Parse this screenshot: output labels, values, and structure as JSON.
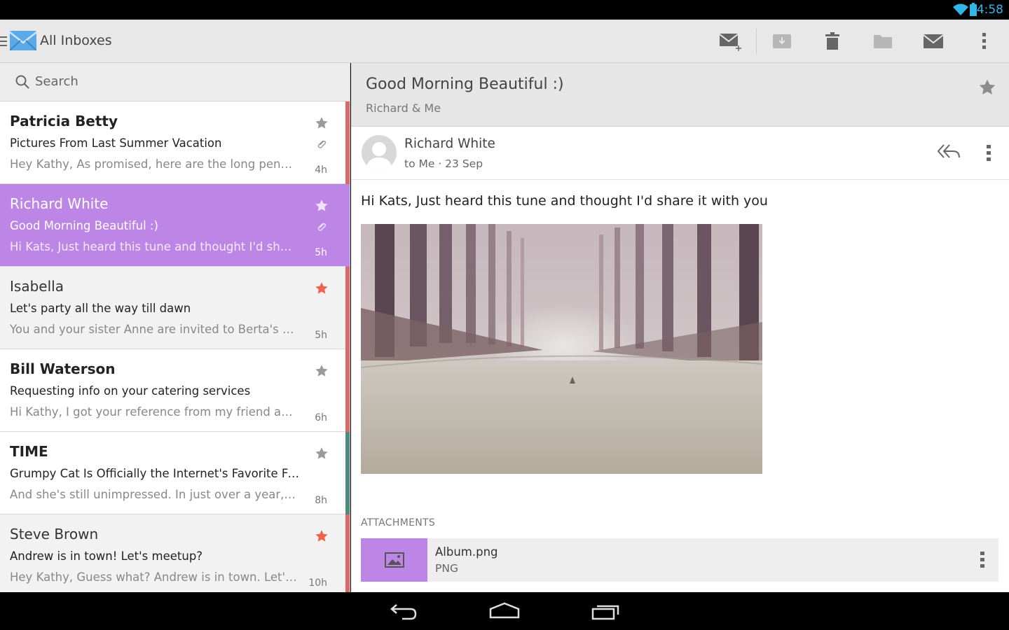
{
  "status": {
    "time": "4:58"
  },
  "appbar": {
    "title": "All Inboxes",
    "icons": [
      "compose-icon",
      "archive-icon",
      "trash-icon",
      "folder-icon",
      "mail-icon",
      "overflow-icon"
    ]
  },
  "search": {
    "placeholder": "Search"
  },
  "mails": [
    {
      "sender": "Patricia Betty",
      "subject": "Pictures From Last Summer Vacation",
      "preview": "Hey Kathy, As promised, here are the long pending pictures from our summer vacation",
      "time": "4h",
      "starred": false,
      "attachment": true,
      "state": "unread",
      "bar_color": "#d96a6a"
    },
    {
      "sender": "Richard White",
      "subject": "Good Morning Beautiful :)",
      "preview": "Hi Kats, Just heard this tune and thought I'd share it with you",
      "time": "5h",
      "starred": false,
      "attachment": true,
      "state": "selected",
      "bar_color": "#bd86e6"
    },
    {
      "sender": "Isabella",
      "subject": "Let's party all the way till dawn",
      "preview": "You and your sister Anne are invited to Berta's backyard party",
      "time": "5h",
      "starred": true,
      "attachment": false,
      "state": "read",
      "bar_color": "#d96a6a"
    },
    {
      "sender": "Bill Waterson",
      "subject": "Requesting info on your catering services",
      "preview": "Hi Kathy, I got your reference from my friend and would like to know more",
      "time": "6h",
      "starred": false,
      "attachment": false,
      "state": "unread",
      "bar_color": "#d96a6a"
    },
    {
      "sender": "TIME",
      "subject": "Grumpy Cat Is Officially the Internet's Favorite Feline",
      "preview": "And she's still unimpressed. In just over a year, Grumpy Cat has become",
      "time": "8h",
      "starred": false,
      "attachment": false,
      "state": "unread",
      "bar_color": "#4f8a7f"
    },
    {
      "sender": "Steve Brown",
      "subject": "Andrew is in town! Let's meetup?",
      "preview": "Hey Kathy, Guess what? Andrew is in town. Let's all meet up tonight",
      "time": "10h",
      "starred": true,
      "attachment": false,
      "state": "read",
      "bar_color": "#d96a6a"
    }
  ],
  "thread": {
    "subject": "Good Morning Beautiful :)",
    "participants": "Richard & Me",
    "message": {
      "from": "Richard White",
      "meta": "to Me · 23 Sep",
      "body": "Hi Kats, Just heard this tune and thought I'd share it with you"
    },
    "attachments_label": "ATTACHMENTS",
    "attachment": {
      "name": "Album.png",
      "type": "PNG"
    }
  },
  "colors": {
    "accent": "#bd86e6",
    "star_on": "#f0624d",
    "star_off": "#9a9a9a",
    "status_blue": "#33b5e5"
  }
}
